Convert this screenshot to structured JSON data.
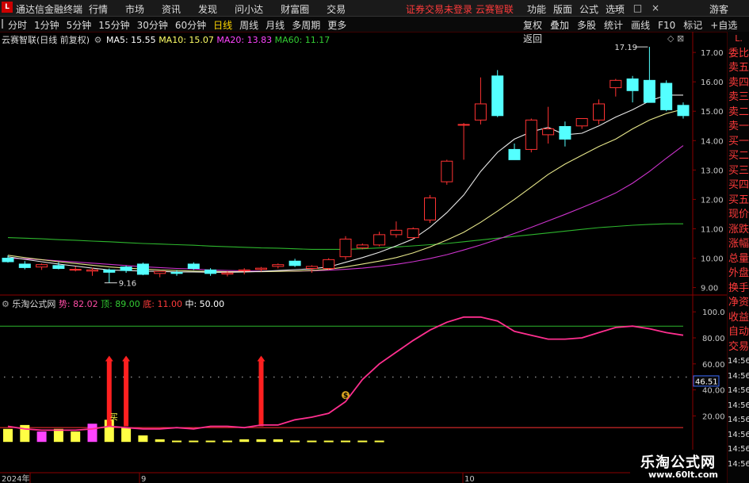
{
  "app": {
    "logo": "L",
    "title": "通达信金融终端"
  },
  "menu": [
    "行情",
    "市场",
    "资讯",
    "发现",
    "问小达",
    "财富圈",
    "交易"
  ],
  "notice": "证券交易未登录   云赛智联",
  "right_menu": [
    "功能",
    "版面",
    "公式",
    "选项"
  ],
  "window_controls": "— □ ×",
  "guest": "游客",
  "periods": [
    "分时",
    "1分钟",
    "5分钟",
    "15分钟",
    "30分钟",
    "60分钟",
    "日线",
    "周线",
    "月线",
    "多周期",
    "更多"
  ],
  "active_period": "日线",
  "toolbar": [
    "复权",
    "叠加",
    "多股",
    "统计",
    "画线",
    "F10",
    "标记",
    "+自选",
    "返回"
  ],
  "main_chart": {
    "title": "云赛智联(日线 前复权)",
    "ma": [
      {
        "label": "MA5: 15.55",
        "color": "#ffffff"
      },
      {
        "label": "MA10: 15.07",
        "color": "#ffff66"
      },
      {
        "label": "MA20: 13.83",
        "color": "#ff44ff"
      },
      {
        "label": "MA60: 11.17",
        "color": "#33cc33"
      }
    ],
    "high_label": "17.19",
    "low_label": "9.16",
    "y_ticks": [
      "17.00",
      "16.00",
      "15.00",
      "14.00",
      "13.00",
      "12.00",
      "11.00",
      "10.00",
      "9.00"
    ],
    "corner_icons": "◇ ⊠"
  },
  "sub_chart": {
    "title": "乐淘公式网",
    "items": [
      {
        "label": "势: 82.02",
        "color": "#ff4da6"
      },
      {
        "label": "顶: 89.00",
        "color": "#33cc33"
      },
      {
        "label": "底: 11.00",
        "color": "#ff3b3b"
      },
      {
        "label": "中: 50.00",
        "color": "#ffffff"
      }
    ],
    "y_ticks": [
      "100.0",
      "80.00",
      "60.00",
      "40.00",
      "20.00"
    ],
    "current_tag": "46.51",
    "signal_text": "$",
    "buy_text": "买"
  },
  "x_labels": [
    "2024年",
    "9",
    "10"
  ],
  "sidebar": [
    "委比",
    "卖五",
    "卖四",
    "卖三",
    "卖二",
    "卖一",
    "买一",
    "买二",
    "买三",
    "买四",
    "买五",
    "现价",
    "涨跌",
    "涨幅",
    "总量",
    "外盘",
    "换手",
    "净资",
    "收益",
    "自动",
    "交易",
    "14:56",
    "14:56",
    "14:56",
    "14:56",
    "14:56",
    "14:56",
    "14:56",
    "14:56"
  ],
  "sidebar_header": "L.",
  "watermark": {
    "name": "乐淘公式网",
    "url": "www.60lt.com"
  },
  "chart_data": [
    {
      "type": "candlestick",
      "ylim": [
        8.8,
        17.3
      ],
      "ohlc": [
        [
          10.0,
          10.1,
          9.85,
          9.88
        ],
        [
          9.8,
          9.9,
          9.62,
          9.68
        ],
        [
          9.7,
          9.82,
          9.6,
          9.78
        ],
        [
          9.75,
          9.86,
          9.62,
          9.65
        ],
        [
          9.6,
          9.72,
          9.55,
          9.62
        ],
        [
          9.56,
          9.68,
          9.4,
          9.6
        ],
        [
          9.6,
          9.65,
          9.16,
          9.52
        ],
        [
          9.7,
          9.75,
          9.5,
          9.58
        ],
        [
          9.8,
          9.85,
          9.42,
          9.45
        ],
        [
          9.48,
          9.56,
          9.35,
          9.55
        ],
        [
          9.52,
          9.6,
          9.4,
          9.48
        ],
        [
          9.8,
          9.86,
          9.6,
          9.65
        ],
        [
          9.6,
          9.66,
          9.4,
          9.48
        ],
        [
          9.46,
          9.55,
          9.38,
          9.5
        ],
        [
          9.58,
          9.66,
          9.45,
          9.6
        ],
        [
          9.62,
          9.7,
          9.55,
          9.66
        ],
        [
          9.72,
          9.82,
          9.65,
          9.78
        ],
        [
          9.9,
          9.98,
          9.7,
          9.75
        ],
        [
          9.65,
          9.76,
          9.5,
          9.72
        ],
        [
          9.65,
          10.0,
          9.6,
          9.95
        ],
        [
          10.05,
          10.75,
          9.95,
          10.65
        ],
        [
          10.35,
          10.5,
          10.3,
          10.45
        ],
        [
          10.45,
          10.9,
          10.4,
          10.8
        ],
        [
          10.8,
          11.25,
          10.7,
          10.95
        ],
        [
          10.7,
          11.05,
          10.65,
          11.0
        ],
        [
          11.3,
          12.15,
          11.2,
          12.05
        ],
        [
          12.6,
          13.35,
          12.5,
          13.3
        ],
        [
          14.55,
          14.6,
          13.35,
          14.55
        ],
        [
          14.7,
          16.15,
          14.55,
          15.25
        ],
        [
          16.2,
          16.4,
          14.8,
          14.85
        ],
        [
          13.7,
          13.9,
          13.35,
          13.35
        ],
        [
          13.7,
          14.75,
          13.6,
          14.7
        ],
        [
          14.2,
          15.15,
          13.9,
          14.4
        ],
        [
          14.48,
          14.65,
          13.8,
          14.05
        ],
        [
          14.5,
          14.7,
          14.4,
          14.75
        ],
        [
          14.7,
          15.4,
          14.55,
          15.25
        ],
        [
          15.8,
          16.1,
          15.5,
          16.05
        ],
        [
          16.1,
          16.2,
          15.3,
          15.7
        ],
        [
          16.05,
          17.19,
          15.6,
          15.3
        ],
        [
          15.95,
          16.05,
          15.0,
          15.05
        ],
        [
          15.2,
          15.3,
          14.75,
          14.85
        ]
      ],
      "ma5": [
        10.05,
        9.96,
        9.88,
        9.8,
        9.73,
        9.66,
        9.6,
        9.58,
        9.56,
        9.55,
        9.53,
        9.53,
        9.52,
        9.52,
        9.53,
        9.55,
        9.58,
        9.61,
        9.64,
        9.7,
        9.86,
        10.02,
        10.2,
        10.42,
        10.65,
        11.05,
        11.55,
        12.15,
        12.95,
        13.6,
        14.05,
        14.3,
        14.45,
        14.2,
        14.25,
        14.5,
        14.8,
        15.05,
        15.35,
        15.55,
        15.55
      ],
      "ma10": [
        10.1,
        10.02,
        9.95,
        9.88,
        9.82,
        9.76,
        9.7,
        9.66,
        9.63,
        9.6,
        9.58,
        9.56,
        9.55,
        9.54,
        9.54,
        9.54,
        9.55,
        9.56,
        9.58,
        9.62,
        9.7,
        9.8,
        9.9,
        10.02,
        10.18,
        10.38,
        10.62,
        10.88,
        11.22,
        11.6,
        12.0,
        12.42,
        12.85,
        13.2,
        13.5,
        13.8,
        14.05,
        14.4,
        14.7,
        14.92,
        15.07
      ],
      "ma20": [
        10.0,
        9.98,
        9.95,
        9.91,
        9.87,
        9.83,
        9.79,
        9.75,
        9.71,
        9.68,
        9.65,
        9.63,
        9.6,
        9.58,
        9.57,
        9.56,
        9.56,
        9.56,
        9.57,
        9.59,
        9.62,
        9.66,
        9.72,
        9.79,
        9.88,
        9.99,
        10.12,
        10.28,
        10.45,
        10.64,
        10.84,
        11.05,
        11.27,
        11.49,
        11.72,
        11.96,
        12.22,
        12.55,
        12.95,
        13.4,
        13.83
      ],
      "ma60": [
        10.7,
        10.68,
        10.66,
        10.63,
        10.61,
        10.58,
        10.56,
        10.53,
        10.5,
        10.48,
        10.46,
        10.44,
        10.41,
        10.39,
        10.37,
        10.35,
        10.34,
        10.32,
        10.3,
        10.3,
        10.3,
        10.32,
        10.35,
        10.38,
        10.42,
        10.46,
        10.5,
        10.56,
        10.62,
        10.68,
        10.74,
        10.8,
        10.86,
        10.92,
        10.98,
        11.04,
        11.08,
        11.12,
        11.15,
        11.17,
        11.17
      ]
    },
    {
      "type": "line",
      "ylim": [
        -20,
        105
      ],
      "top": 89.0,
      "bottom": 11.0,
      "trend": [
        12,
        10,
        9,
        9,
        9,
        10,
        12,
        11,
        10,
        10,
        11,
        10,
        12,
        12,
        11,
        13,
        13,
        17,
        19,
        22,
        31,
        48,
        60,
        69,
        78,
        86,
        92,
        96,
        96,
        93,
        85,
        82,
        79,
        79,
        80,
        84,
        88,
        89,
        87,
        84,
        82
      ],
      "bars": [
        10,
        13,
        8,
        10,
        8,
        14,
        17,
        11,
        5,
        2,
        1,
        1,
        1,
        1,
        2,
        2,
        2,
        1,
        1,
        1,
        1,
        1,
        1
      ],
      "signal_indices": [
        6,
        7,
        15
      ]
    }
  ]
}
